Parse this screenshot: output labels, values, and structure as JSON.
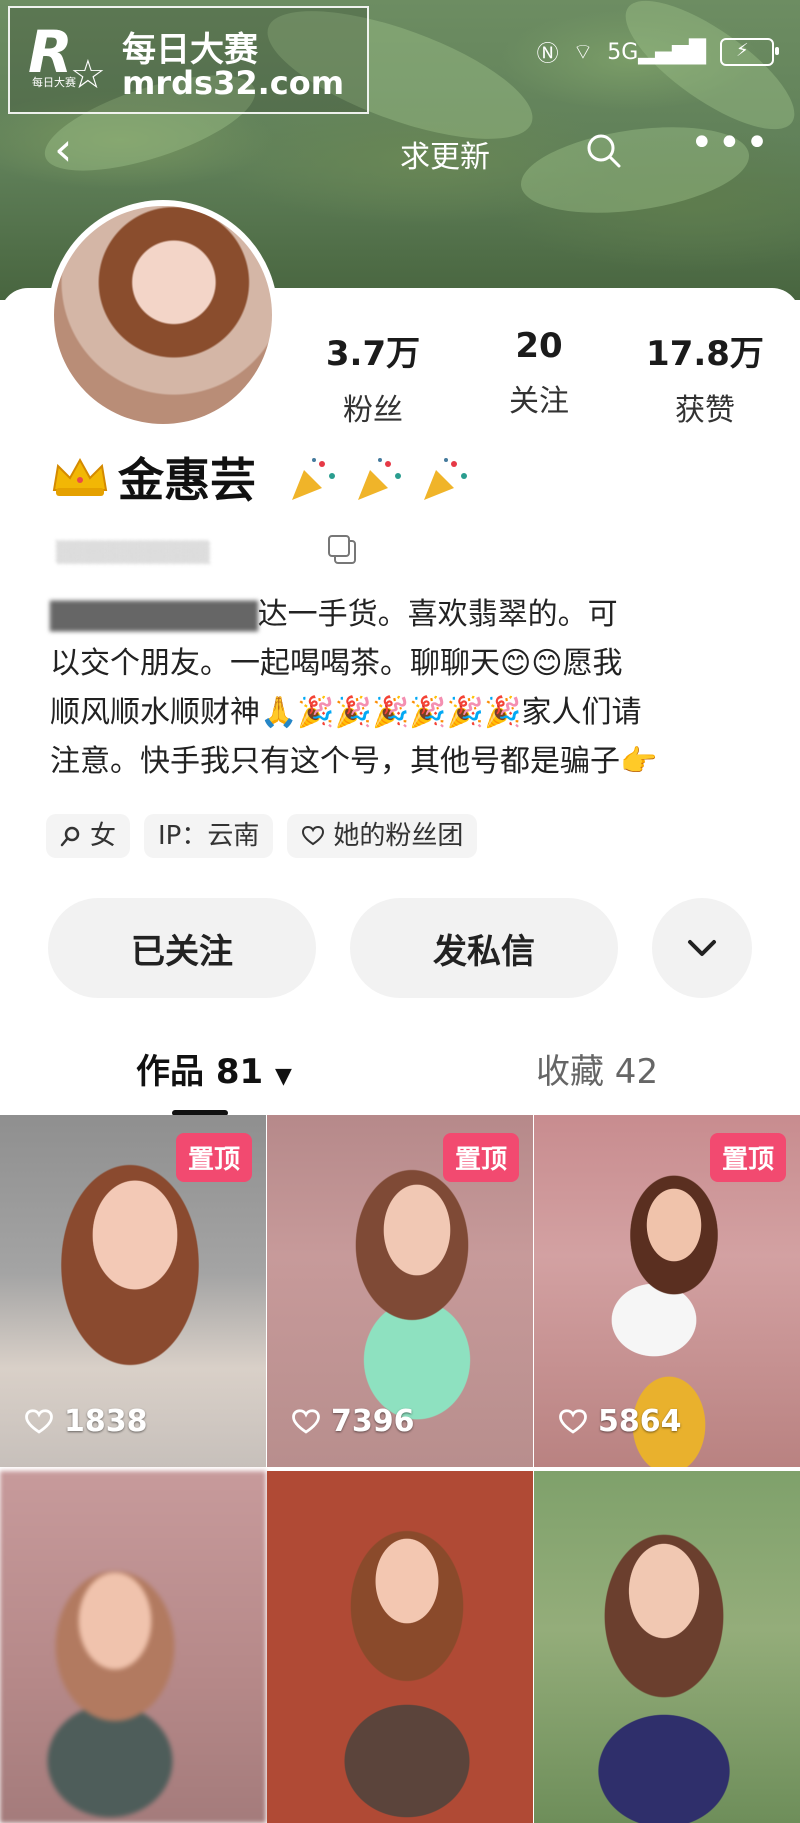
{
  "watermark": {
    "logo_letter": "R",
    "logo_small": "每日大赛",
    "line1": "每日大赛",
    "line2": "mrds32.com"
  },
  "nav": {
    "title": "求更新",
    "back_icon": "chevron-left-icon",
    "search_icon": "search-icon",
    "more_icon": "more-horizontal-icon"
  },
  "profile": {
    "stats": [
      {
        "value": "3.7万",
        "label": "粉丝"
      },
      {
        "value": "20",
        "label": "关注"
      },
      {
        "value": "17.8万",
        "label": "获赞"
      }
    ],
    "name": "金惠芸",
    "bio_lines": [
      "喜欢翡翠的。可",
      "以交个朋友。一起喝喝茶。聊聊天",
      "顺风顺水顺财神",
      "家人们请",
      "注意。快手我只有这个号，其他号都是骗子"
    ],
    "bio_prefix_fragment": "达一手货。",
    "emoji_smile": "😊😊",
    "emoji_bless_tail": "愿我",
    "emoji_pray": "🙏",
    "emoji_party": "🎉🎉🎉🎉🎉🎉",
    "emoji_point": "👉",
    "tags": [
      {
        "icon": "search-icon",
        "label": "女"
      },
      {
        "icon": "",
        "label": "IP：云南"
      },
      {
        "icon": "heart-outline-icon",
        "label": "她的粉丝团"
      }
    ]
  },
  "actions": {
    "follow": "已关注",
    "message": "发私信",
    "more_icon": "chevron-down-icon"
  },
  "tabs": {
    "works": "作品 81",
    "works_icon": "caret-down-icon",
    "favorites": "收藏 42"
  },
  "grid": {
    "pin_label": "置顶",
    "items": [
      {
        "likes": "1838",
        "pinned": true
      },
      {
        "likes": "7396",
        "pinned": true
      },
      {
        "likes": "5864",
        "pinned": true
      },
      {
        "likes": "",
        "pinned": false
      },
      {
        "likes": "",
        "pinned": false
      },
      {
        "likes": "",
        "pinned": false
      }
    ]
  },
  "colors": {
    "pin_bg": "#f24a70",
    "button_bg": "#f2f2f2",
    "text_dark": "#111111"
  }
}
